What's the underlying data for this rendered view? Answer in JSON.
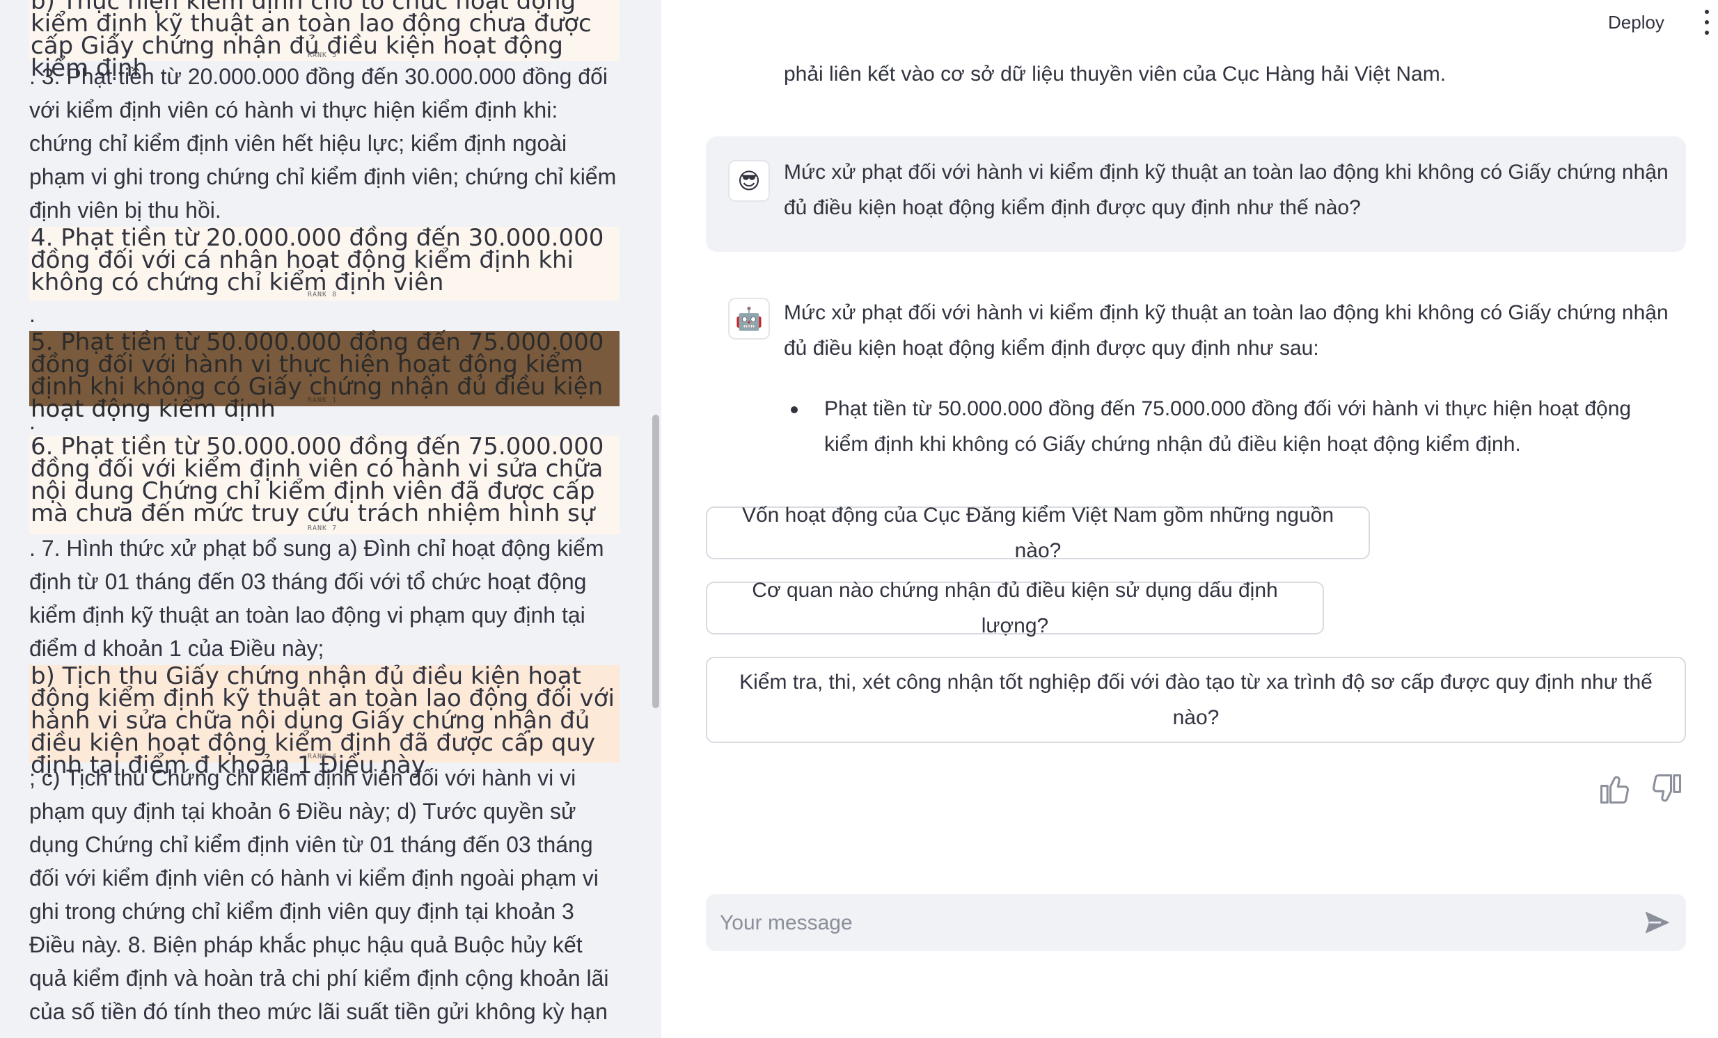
{
  "sidebar": {
    "blocks": [
      {
        "text": "b) Thực hiện kiểm định cho tổ chức hoạt động kiểm định kỹ thuật an toàn lao động chưa được cấp Giấy chứng nhận đủ điều kiện hoạt động kiểm định",
        "rank": "RANK 5"
      },
      {
        "text": ". 3. Phạt tiền từ 20.000.000 đồng đến 30.000.000 đồng đối với kiểm định viên có hành vi thực hiện kiểm định khi: chứng chỉ kiểm định viên hết hiệu lực; kiểm định ngoài phạm vi ghi trong chứng chỉ kiểm định viên; chứng chỉ kiểm định viên bị thu hồi."
      },
      {
        "text": "4. Phạt tiền từ 20.000.000 đồng đến 30.000.000 đồng đối với cá nhân hoạt động kiểm định khi không có chứng chỉ kiểm định viên",
        "rank": "RANK 8"
      },
      {
        "text": "."
      },
      {
        "text": "5. Phạt tiền từ 50.000.000 đồng đến 75.000.000 đồng đối với hành vi thực hiện hoạt động kiểm định khi không có Giấy chứng nhận đủ điều kiện hoạt động kiểm định",
        "rank": "RANK 1"
      },
      {
        "text": "."
      },
      {
        "text": "6. Phạt tiền từ 50.000.000 đồng đến 75.000.000 đồng đối với kiểm định viên có hành vi sửa chữa nội dung Chứng chỉ kiểm định viên đã được cấp mà chưa đến mức truy cứu trách nhiệm hình sự",
        "rank": "RANK 7"
      },
      {
        "text": ". 7. Hình thức xử phạt bổ sung a) Đình chỉ hoạt động kiểm định từ 01 tháng đến 03 tháng đối với tổ chức hoạt động kiểm định kỹ thuật an toàn lao động vi phạm quy định tại điểm d khoản 1 của Điều này;"
      },
      {
        "text": "b) Tịch thu Giấy chứng nhận đủ điều kiện hoạt động kiểm định kỹ thuật an toàn lao động đối với hành vi sửa chữa nội dung Giấy chứng nhận đủ điều kiện hoạt động kiểm định đã được cấp quy định tại điểm đ khoản 1 Điều này",
        "rank": "RANK 4"
      },
      {
        "text": "; c) Tịch thu Chứng chỉ kiểm định viên đối với hành vi vi phạm quy định tại khoản 6 Điều này; d) Tước quyền sử dụng Chứng chỉ kiểm định viên từ 01 tháng đến 03 tháng đối với kiểm định viên có hành vi kiểm định ngoài phạm vi ghi trong chứng chỉ kiểm định viên quy định tại khoản 3 Điều này. 8. Biện pháp khắc phục hậu quả Buộc hủy kết quả kiểm định và hoàn trả chi phí kiểm định cộng khoản lãi của số tiền đó tính theo mức lãi suất tiền gửi không kỳ hạn"
      }
    ],
    "highlight_colors": {
      "rank5": "#fdf6ee",
      "rank8": "#fdf6ee",
      "rank1": "#7a5a3c",
      "rank7": "#fdf6ee",
      "rank4": "#fde9d8"
    }
  },
  "header": {
    "deploy_label": "Deploy",
    "menu_icon": "kebab-menu-icon"
  },
  "chat": {
    "prev_assistant_tail": "phải liên kết vào cơ sở dữ liệu thuyền viên của Cục Hàng hải Việt Nam.",
    "user_avatar": "😎",
    "user_message": "Mức xử phạt đối với hành vi kiểm định kỹ thuật an toàn lao động khi không có Giấy chứng nhận đủ điều kiện hoạt động kiểm định được quy định như thế nào?",
    "bot_avatar": "🤖",
    "bot_message": "Mức xử phạt đối với hành vi kiểm định kỹ thuật an toàn lao động khi không có Giấy chứng nhận đủ điều kiện hoạt động kiểm định được quy định như sau:",
    "bot_bullets": [
      "Phạt tiền từ 50.000.000 đồng đến 75.000.000 đồng đối với hành vi thực hiện hoạt động kiểm định khi không có Giấy chứng nhận đủ điều kiện hoạt động kiểm định."
    ],
    "suggestions": [
      "Vốn hoạt động của Cục Đăng kiểm Việt Nam gồm những nguồn nào?",
      "Cơ quan nào chứng nhận đủ điều kiện sử dụng dấu định lượng?",
      "Kiểm tra, thi, xét công nhận tốt nghiệp đối với đào tạo từ xa trình độ sơ cấp được quy định như thế nào?"
    ],
    "feedback": [
      "thumbs-up-icon",
      "thumbs-down-icon"
    ],
    "input_placeholder": "Your message",
    "input_value": "",
    "send_icon": "send-icon",
    "accent": "#31333f",
    "panel_bg": "#f0f2f6"
  }
}
